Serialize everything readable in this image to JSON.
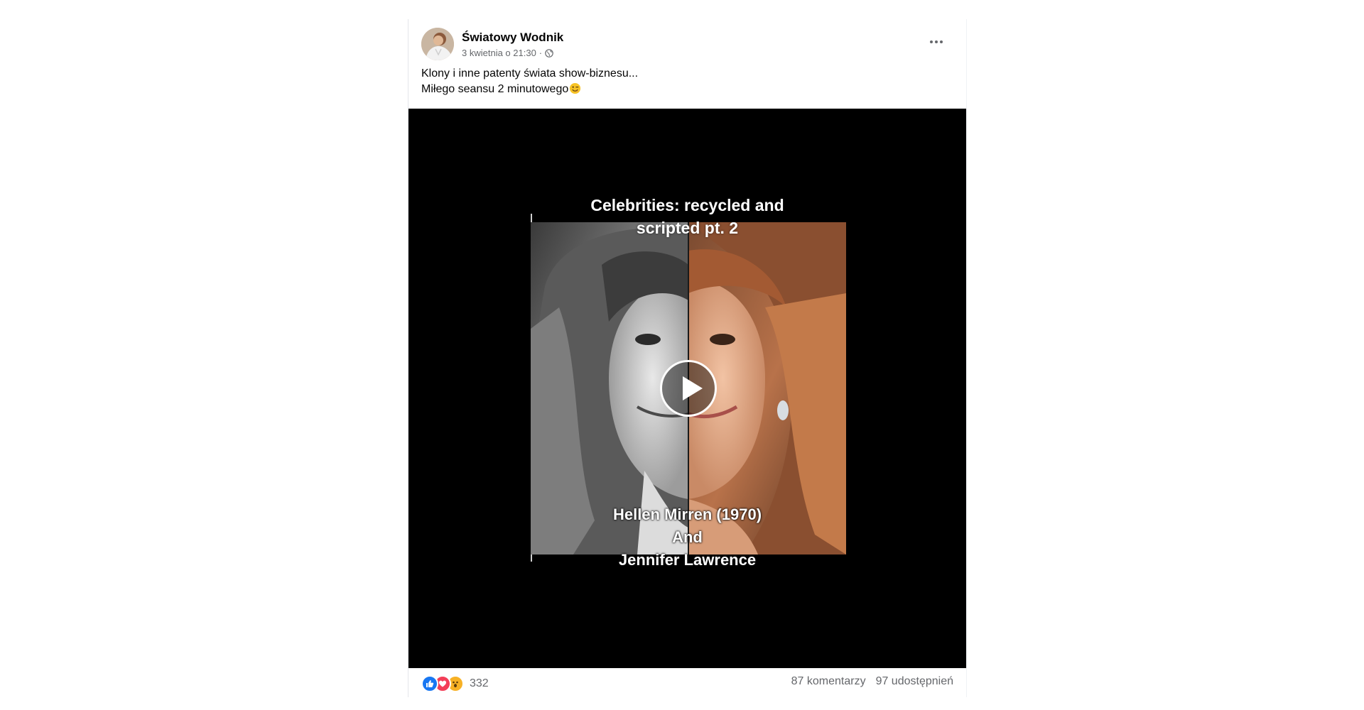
{
  "post": {
    "author": "Światowy Wodnik",
    "timestamp": "3 kwietnia o 21:30",
    "separator": "·",
    "privacy_icon": "globe-icon",
    "more_icon": "more-options-icon",
    "text_lines": [
      "Klony i inne patenty świata show-biznesu...",
      "Miłego seansu 2 minutowego"
    ],
    "emoji": "wink-emoji"
  },
  "video": {
    "title_lines": [
      "Celebrities: recycled and",
      "scripted pt. 2"
    ],
    "caption_lines": [
      "Hellen Mirren (1970)",
      "And",
      "Jennifer Lawrence"
    ],
    "play_icon": "play-icon"
  },
  "footer": {
    "reactions": [
      "like-reaction-icon",
      "love-reaction-icon",
      "wow-reaction-icon"
    ],
    "reaction_count": "332",
    "comments": "87 komentarzy",
    "shares": "97 udostępnień"
  },
  "colors": {
    "brand_blue": "#1877f2",
    "love_red": "#f33e58",
    "wow_yellow": "#f7b125",
    "secondary_text": "#65676b"
  }
}
